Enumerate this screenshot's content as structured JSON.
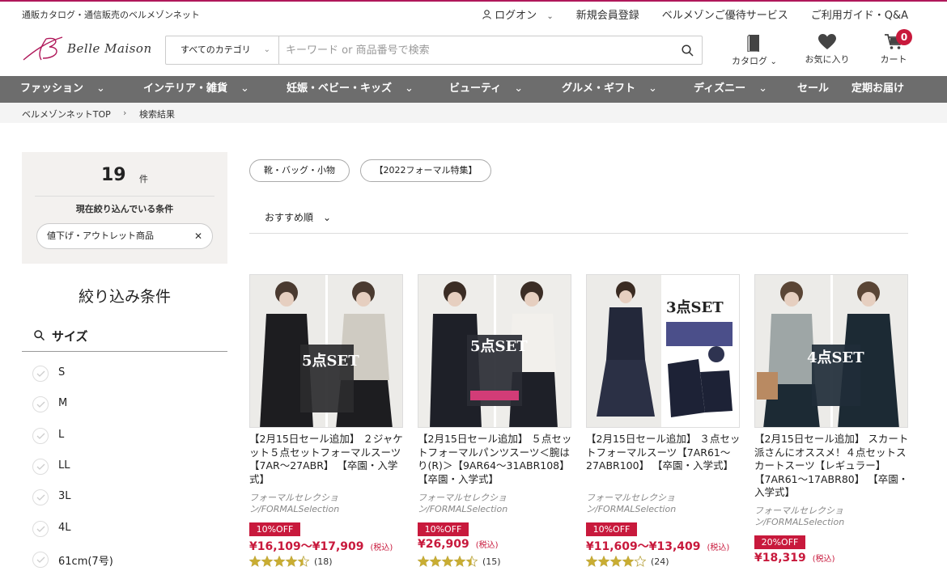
{
  "header": {
    "tagline": "通販カタログ・通信販売のベルメゾンネット",
    "links": [
      "ログオン",
      "新規会員登録",
      "ベルメゾンご優待サービス",
      "ご利用ガイド・Q&A"
    ],
    "logo_text": "Belle Maison",
    "search": {
      "category": "すべてのカテゴリ",
      "placeholder": "キーワード or 商品番号で検索"
    },
    "icons": {
      "catalog": "カタログ",
      "favorites": "お気に入り",
      "cart": "カート",
      "cart_count": "0"
    }
  },
  "nav": [
    "ファッション",
    "インテリア・雑貨",
    "妊娠・ベビー・キッズ",
    "ビューティ",
    "グルメ・ギフト",
    "ディズニー",
    "セール",
    "定期お届け"
  ],
  "breadcrumb": [
    "ベルメゾンネットTOP",
    "検索結果"
  ],
  "summary": {
    "count": "19",
    "unit": "件",
    "current_title": "現在絞り込んでいる条件",
    "chip": "値下げ・アウトレット商品"
  },
  "filter": {
    "title": "絞り込み条件",
    "size_heading": "サイズ",
    "sizes": [
      "S",
      "M",
      "L",
      "LL",
      "3L",
      "4L",
      "61cm(7号)"
    ]
  },
  "tags": [
    "靴・バッグ・小物",
    "【2022フォーマル特集】"
  ],
  "sort": "おすすめ順",
  "products": [
    {
      "name": "【2月15日セール追加】 ２ジャケット５点セットフォーマルスーツ【7AR〜27ABR】 【卒園・入学式】",
      "brand": "フォーマルセレクション/FORMALSelection",
      "off": "10%OFF",
      "price": "¥16,109〜¥17,909",
      "tax": "(税込)",
      "reviews": "(18)",
      "rating": 4.5,
      "set_label": "5点SET"
    },
    {
      "name": "【2月15日セール追加】 ５点セットフォーマルパンツスーツ＜腕はり(R)＞【9AR64〜31ABR108】 【卒園・入学式】",
      "brand": "フォーマルセレクション/FORMALSelection",
      "off": "10%OFF",
      "price": "¥26,909",
      "tax": "(税込)",
      "reviews": "(15)",
      "rating": 4.5,
      "set_label": "5点SET"
    },
    {
      "name": "【2月15日セール追加】 ３点セットフォーマルスーツ【7AR61〜27ABR100】 【卒園・入学式】",
      "brand": "フォーマルセレクション/FORMALSelection",
      "off": "10%OFF",
      "price": "¥11,609〜¥13,409",
      "tax": "(税込)",
      "reviews": "(24)",
      "rating": 4.0,
      "set_label": "3点SET"
    },
    {
      "name": "【2月15日セール追加】 スカート派さんにオススメ！４点セットスカートスーツ【レギュラー】【7AR61〜17ABR80】 【卒園・入学式】",
      "brand": "フォーマルセレクション/FORMALSelection",
      "off": "20%OFF",
      "price": "¥18,319",
      "tax": "(税込)",
      "reviews": "",
      "rating": 0,
      "set_label": "4点SET"
    }
  ],
  "colors": {
    "accent": "#c8193c",
    "nav_bg": "#6d6d6d",
    "brand_line": "#b0185a"
  }
}
